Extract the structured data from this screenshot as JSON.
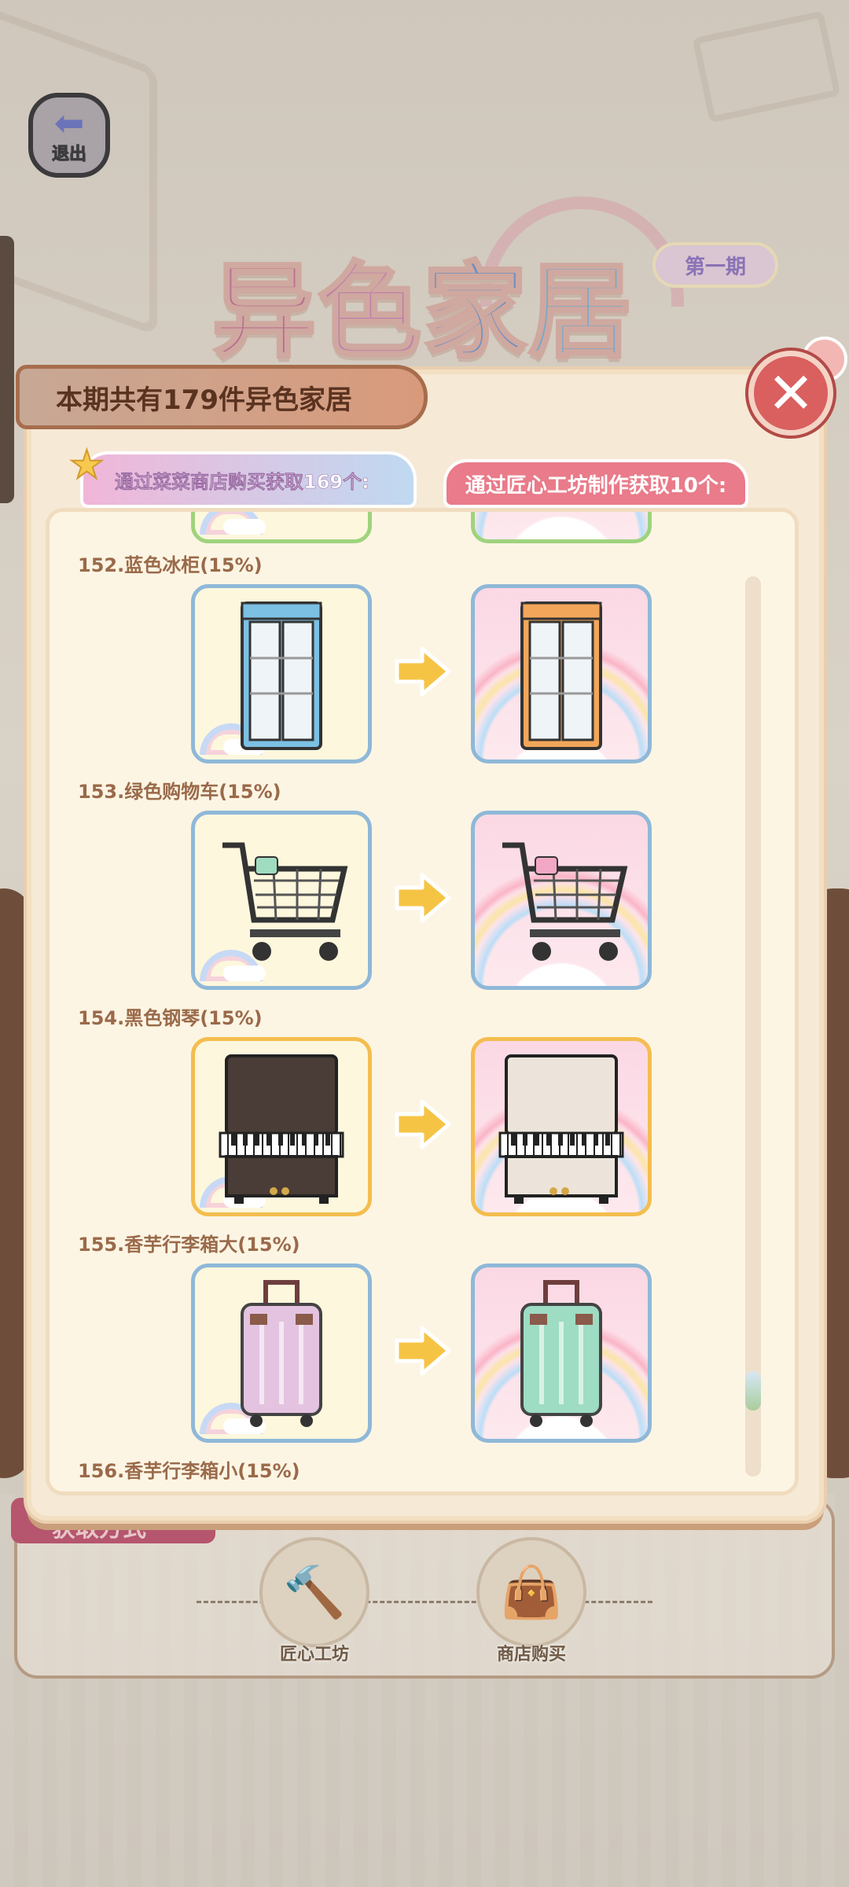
{
  "header": {
    "back_label": "退出",
    "title_chars": [
      "异",
      "色",
      "家",
      "居"
    ],
    "issue_badge": "第一期"
  },
  "dialog": {
    "banner": "本期共有179件异色家居",
    "tab_shop": "通过菜菜商店购买获取169个:",
    "tab_craft": "通过匠心工坊制作获取10个:",
    "close_icon": "close-icon",
    "items": [
      {
        "name": "152.蓝色冰柜(15%)",
        "icon": "fridge-icon",
        "frame": "blue",
        "from_color": "#7cc0e4",
        "to_color": "#f2a65a"
      },
      {
        "name": "153.绿色购物车(15%)",
        "icon": "cart-icon",
        "frame": "blue",
        "from_color": "#9fdcc0",
        "to_color": "#f2a8c4"
      },
      {
        "name": "154.黑色钢琴(15%)",
        "icon": "piano-icon",
        "frame": "gold",
        "from_color": "#4a3c36",
        "to_color": "#ece4da"
      },
      {
        "name": "155.香芋行李箱大(15%)",
        "icon": "suitcase-icon",
        "frame": "blue",
        "from_color": "#e4c3e0",
        "to_color": "#9edcc4"
      }
    ],
    "partial_next_label": "156.香芋行李箱小(15%)",
    "scroll_position": 0.86
  },
  "background": {
    "acquire_label": "获取方式",
    "station_craft": "匠心工坊",
    "station_shop": "商店购买"
  },
  "colors": {
    "accent_close": "#d9605f",
    "banner": "#d99a7b",
    "frame_blue": "#8fb8d8",
    "frame_gold": "#f4bd4e"
  }
}
